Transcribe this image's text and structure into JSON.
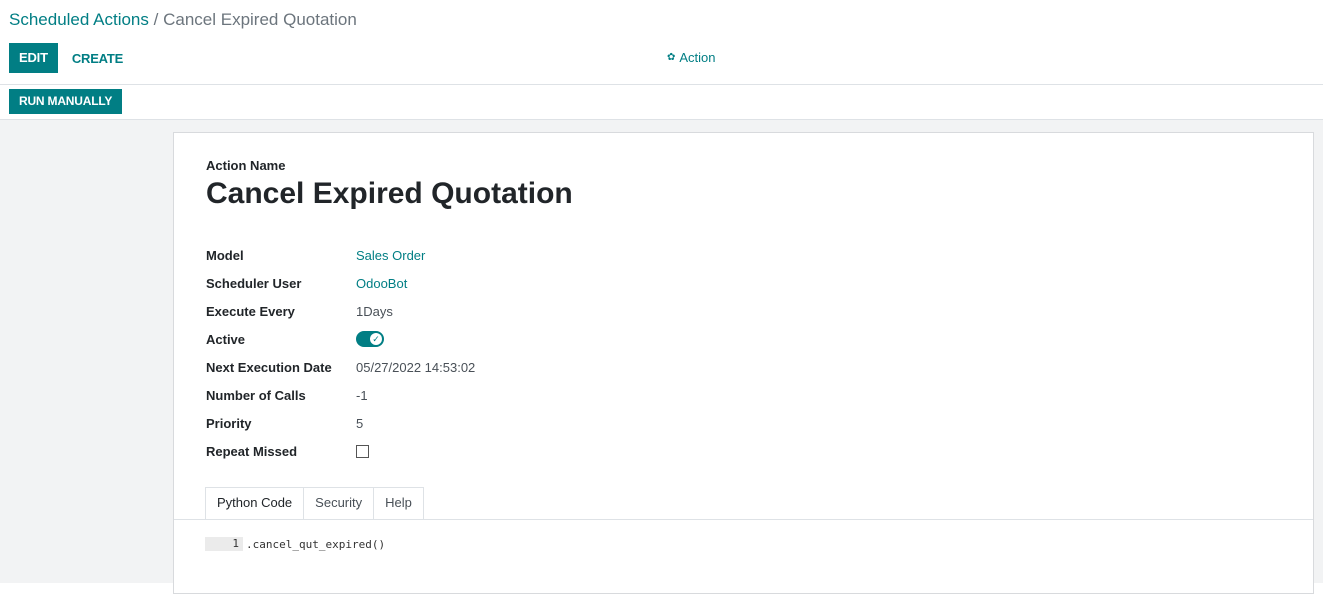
{
  "breadcrumb": {
    "parent": "Scheduled Actions",
    "separator": "/",
    "current": "Cancel Expired Quotation"
  },
  "toolbar": {
    "edit_label": "EDIT",
    "create_label": "CREATE",
    "action_label": "Action",
    "action_icon": "gear-icon",
    "run_label": "RUN MANUALLY"
  },
  "form": {
    "name_label": "Action Name",
    "title": "Cancel Expired Quotation",
    "fields": {
      "model": {
        "label": "Model",
        "value": "Sales Order"
      },
      "scheduler_user": {
        "label": "Scheduler User",
        "value": "OdooBot"
      },
      "execute_every": {
        "label": "Execute Every",
        "value": "1Days"
      },
      "active": {
        "label": "Active",
        "value": true
      },
      "next_execution": {
        "label": "Next Execution Date",
        "value": "05/27/2022 14:53:02"
      },
      "number_of_calls": {
        "label": "Number of Calls",
        "value": "-1"
      },
      "priority": {
        "label": "Priority",
        "value": "5"
      },
      "repeat_missed": {
        "label": "Repeat Missed",
        "value": false
      }
    }
  },
  "tabs": [
    {
      "label": "Python Code",
      "active": true
    },
    {
      "label": "Security",
      "active": false
    },
    {
      "label": "Help",
      "active": false
    }
  ],
  "code": {
    "line_number": "1",
    "line": ".cancel_qut_expired()"
  },
  "colors": {
    "primary": "#017e84",
    "background": "#f2f3f4"
  }
}
